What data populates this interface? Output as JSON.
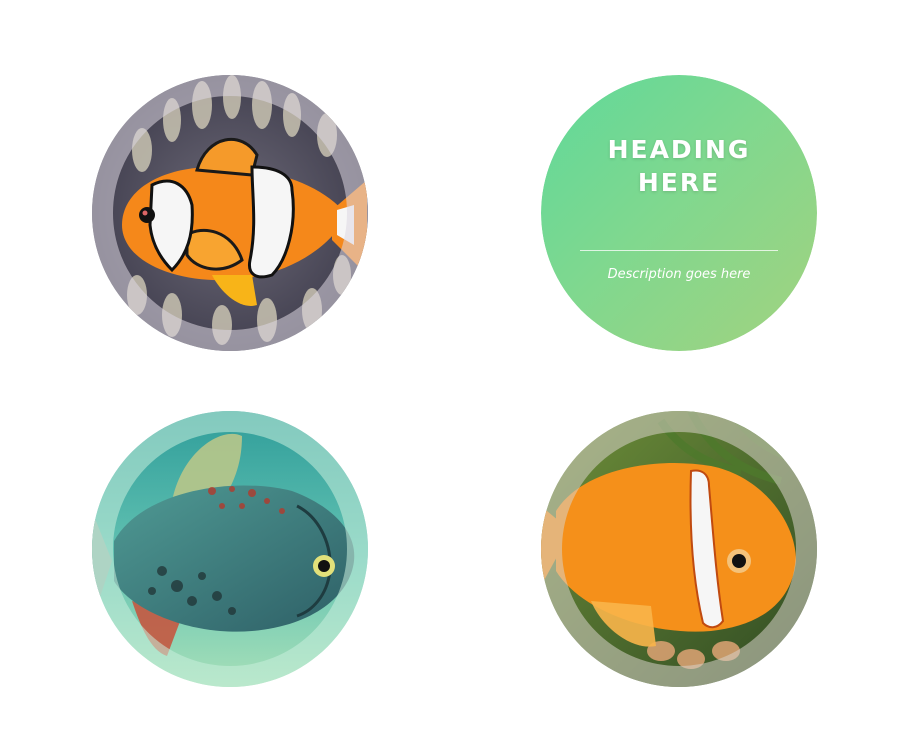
{
  "cards": [
    {
      "kind": "image",
      "icon": "clownfish-image"
    },
    {
      "kind": "text",
      "heading": "HEADING HERE",
      "description": "Description goes here"
    },
    {
      "kind": "image",
      "icon": "pacu-fish-image"
    },
    {
      "kind": "image",
      "icon": "orange-clownfish-image"
    }
  ],
  "colors": {
    "background": "#ffffff",
    "card_gradient_start": "#5fd99a",
    "card_gradient_end": "#a3d27f",
    "clownfish_orange": "#f5881a",
    "stripe_white": "#f6f6f6"
  }
}
